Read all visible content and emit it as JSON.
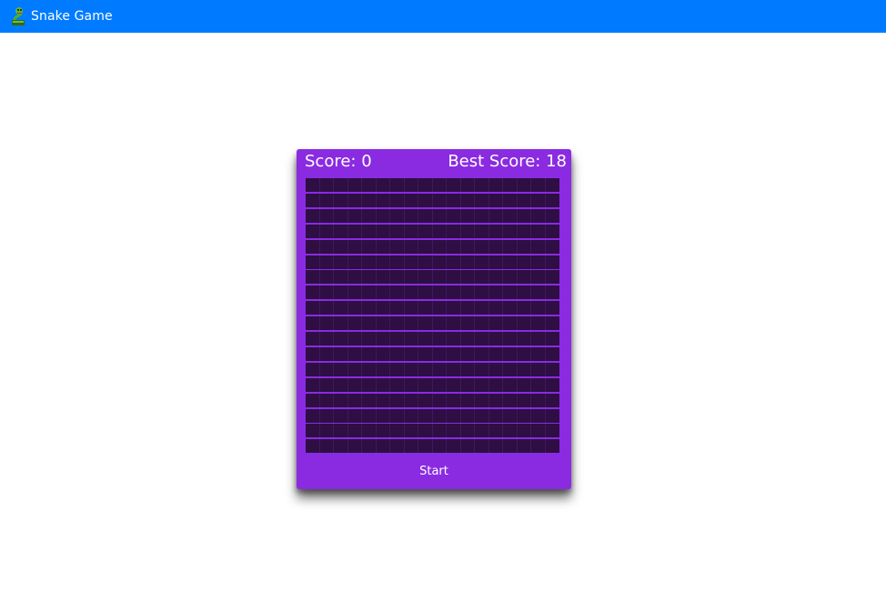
{
  "app": {
    "title": "Snake Game",
    "logo_icon": "snake-icon",
    "bar_color": "#007bff"
  },
  "game": {
    "score_label": "Score: 0",
    "best_score_label": "Best Score: 18",
    "score": 0,
    "best_score": 18,
    "start_label": "Start",
    "panel_color": "#8a2be2",
    "cell_color": "#2e0e43",
    "grid": {
      "rows": 18,
      "columns": 18
    }
  }
}
